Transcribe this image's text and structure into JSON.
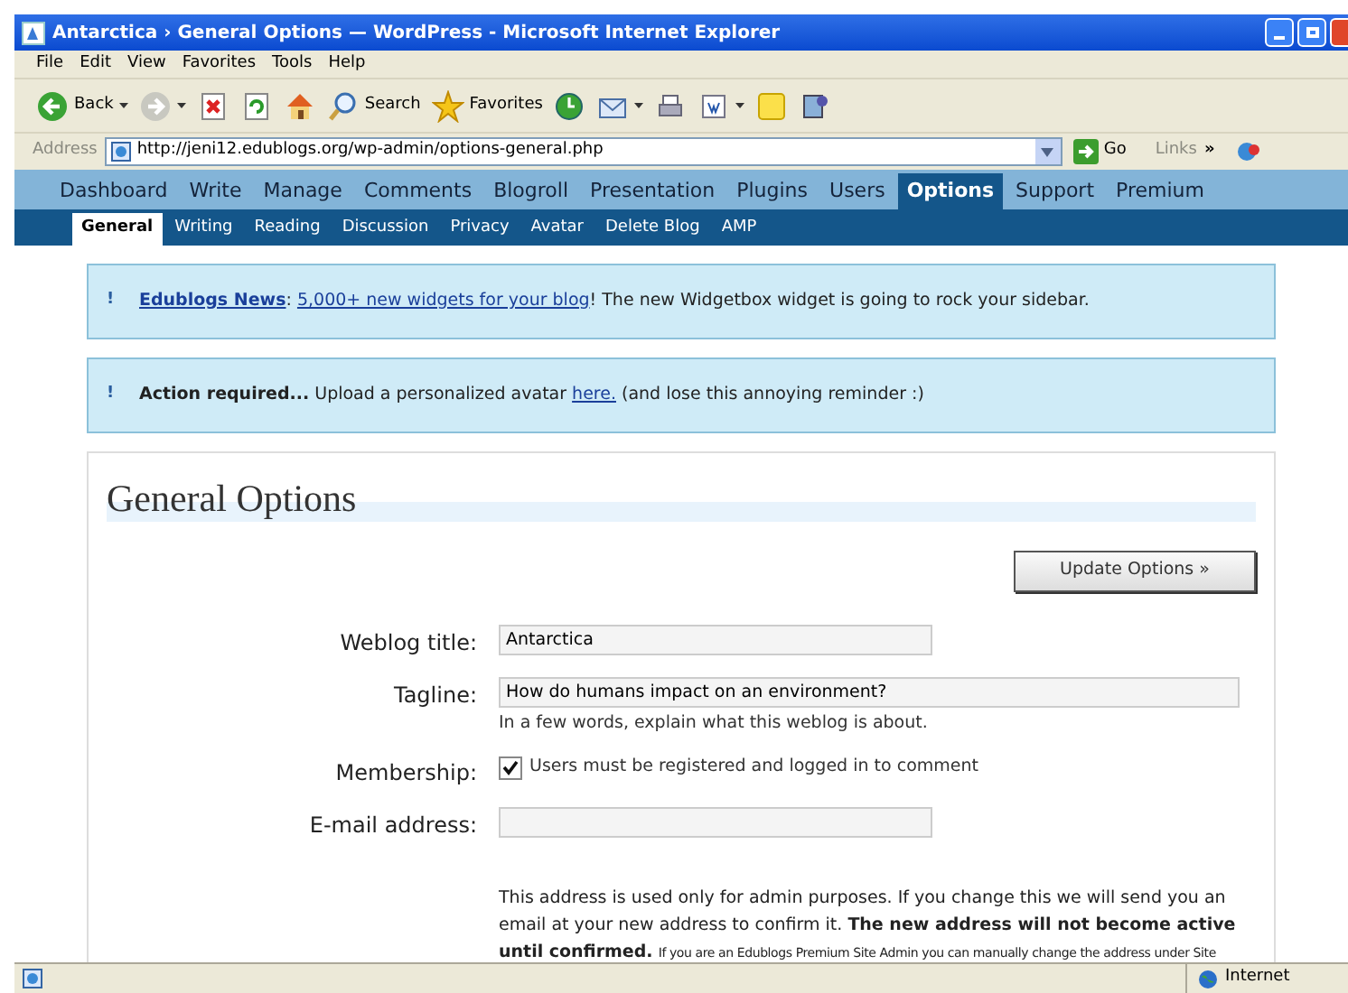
{
  "window": {
    "title": "Antarctica › General Options — WordPress - Microsoft Internet Explorer"
  },
  "menu": [
    "File",
    "Edit",
    "View",
    "Favorites",
    "Tools",
    "Help"
  ],
  "toolbar": [
    {
      "kind": "back",
      "label": "Back",
      "dropdown": true
    },
    {
      "kind": "forward",
      "dropdown": true
    },
    {
      "kind": "stop"
    },
    {
      "kind": "refresh"
    },
    {
      "kind": "home"
    },
    {
      "kind": "search",
      "label": "Search"
    },
    {
      "kind": "favorites",
      "label": "Favorites"
    },
    {
      "kind": "history"
    },
    {
      "kind": "mail",
      "dropdown": true
    },
    {
      "kind": "print"
    },
    {
      "kind": "edit",
      "dropdown": true
    },
    {
      "kind": "note"
    },
    {
      "kind": "messenger"
    }
  ],
  "address": {
    "label": "Address",
    "url": "http://jeni12.edublogs.org/wp-admin/options-general.php",
    "go": "Go",
    "links": "Links",
    "chevron": "»"
  },
  "nav": [
    {
      "label": "Dashboard",
      "selected": false
    },
    {
      "label": "Write",
      "selected": false
    },
    {
      "label": "Manage",
      "selected": false
    },
    {
      "label": "Comments",
      "selected": false
    },
    {
      "label": "Blogroll",
      "selected": false
    },
    {
      "label": "Presentation",
      "selected": false
    },
    {
      "label": "Plugins",
      "selected": false
    },
    {
      "label": "Users",
      "selected": false
    },
    {
      "label": "Options",
      "selected": true
    },
    {
      "label": "Support",
      "selected": false
    },
    {
      "label": "Premium",
      "selected": false
    }
  ],
  "subnav": [
    {
      "label": "General",
      "selected": true
    },
    {
      "label": "Writing",
      "selected": false
    },
    {
      "label": "Reading",
      "selected": false
    },
    {
      "label": "Discussion",
      "selected": false
    },
    {
      "label": "Privacy",
      "selected": false
    },
    {
      "label": "Avatar",
      "selected": false
    },
    {
      "label": "Delete Blog",
      "selected": false
    },
    {
      "label": "AMP",
      "selected": false
    }
  ],
  "notices": [
    {
      "mark": "!",
      "parts": [
        {
          "kind": "strong_link",
          "text": "Edublogs News"
        },
        {
          "kind": "text",
          "text": ": "
        },
        {
          "kind": "link",
          "text": "5,000+ new widgets for your blog"
        },
        {
          "kind": "text",
          "text": "! The new Widgetbox widget is going to rock your sidebar."
        }
      ]
    },
    {
      "mark": "!",
      "parts": [
        {
          "kind": "strong",
          "text": "Action required..."
        },
        {
          "kind": "text",
          "text": " Upload a personalized avatar "
        },
        {
          "kind": "link",
          "text": "here."
        },
        {
          "kind": "text",
          "text": " (and lose this annoying reminder :)"
        }
      ]
    }
  ],
  "page_title": "General Options",
  "update_button": "Update Options »",
  "fields": [
    {
      "kind": "short_text",
      "label": "Weblog title:",
      "value": "Antarctica"
    },
    {
      "kind": "long_text",
      "label": "Tagline:",
      "value": "How do humans impact on an environment?",
      "hint": "In a few words, explain what this weblog is about."
    },
    {
      "kind": "checkbox",
      "label": "Membership:",
      "checked": true,
      "text": "Users must be registered and logged in to comment"
    },
    {
      "kind": "short_text",
      "label": "E-mail address:"
    }
  ],
  "email_help": {
    "text": "This address is used only for admin purposes. If you change this we will send you an email at your new address to confirm it. **The new address will not become active until confirmed.**",
    "note": "If you are an Edublogs Premium Site Admin you can manually change the address under Site"
  },
  "status_bar": {
    "zone": "Internet"
  }
}
